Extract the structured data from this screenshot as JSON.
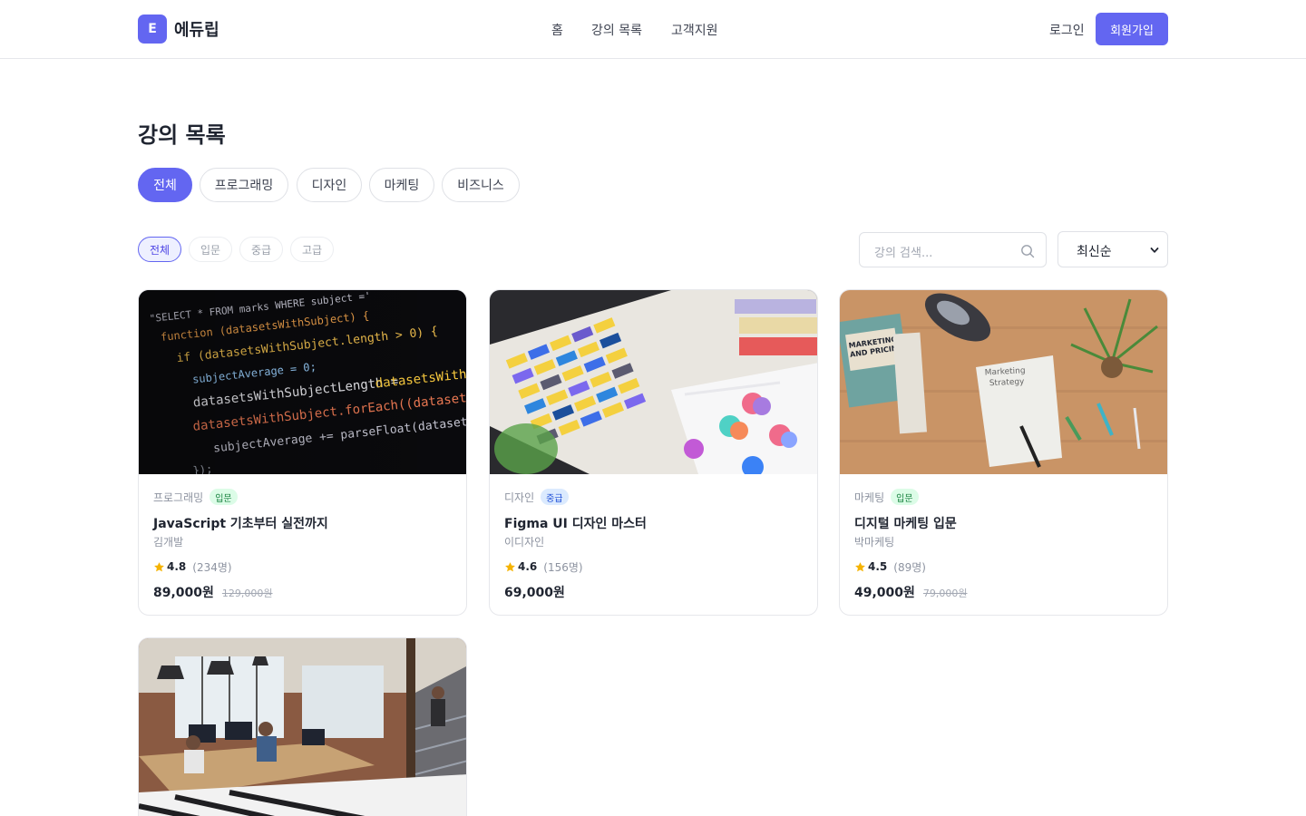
{
  "header": {
    "logo_letter": "E",
    "brand": "에듀립",
    "nav": [
      "홈",
      "강의 목록",
      "고객지원"
    ],
    "login": "로그인",
    "signup": "회원가입"
  },
  "page_title": "강의 목록",
  "categories": [
    {
      "label": "전체",
      "active": true
    },
    {
      "label": "프로그래밍",
      "active": false
    },
    {
      "label": "디자인",
      "active": false
    },
    {
      "label": "마케팅",
      "active": false
    },
    {
      "label": "비즈니스",
      "active": false
    }
  ],
  "levels": [
    {
      "label": "전체",
      "active": true
    },
    {
      "label": "입문",
      "active": false
    },
    {
      "label": "중급",
      "active": false
    },
    {
      "label": "고급",
      "active": false
    }
  ],
  "search": {
    "placeholder": "강의 검색..."
  },
  "sort": {
    "selected": "최신순"
  },
  "colors": {
    "accent": "#6366f1",
    "star": "#f5b301",
    "beginner_bg": "#dcfce7",
    "intermediate_bg": "#dbeafe"
  },
  "courses": [
    {
      "thumbnail": "code-editor-photo",
      "category": "프로그래밍",
      "level": "입문",
      "title": "JavaScript 기초부터 실전까지",
      "instructor": "김개발",
      "rating": "4.8",
      "reviews": "(234명)",
      "price": "89,000원",
      "original_price": "129,000원"
    },
    {
      "thumbnail": "color-swatch-photo",
      "category": "디자인",
      "level": "중급",
      "title": "Figma UI 디자인 마스터",
      "instructor": "이디자인",
      "rating": "4.6",
      "reviews": "(156명)",
      "price": "69,000원",
      "original_price": ""
    },
    {
      "thumbnail": "marketing-desk-photo",
      "category": "마케팅",
      "level": "입문",
      "title": "디지털 마케팅 입문",
      "instructor": "박마케팅",
      "rating": "4.5",
      "reviews": "(89명)",
      "price": "49,000원",
      "original_price": "79,000원"
    },
    {
      "thumbnail": "office-workspace-photo"
    }
  ]
}
